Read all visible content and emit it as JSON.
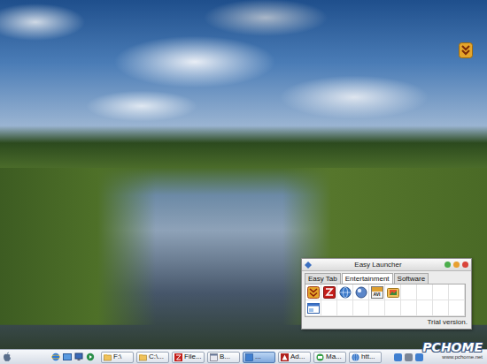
{
  "launcher": {
    "title": "Easy Launcher",
    "tabs": [
      {
        "label": "Easy Tab",
        "selected": false
      },
      {
        "label": "Entertainment",
        "selected": true
      },
      {
        "label": "Software",
        "selected": false
      }
    ],
    "rows": [
      [
        {
          "kind": "download"
        },
        {
          "kind": "filezilla"
        },
        {
          "kind": "globe"
        },
        {
          "kind": "ball"
        },
        {
          "kind": "video",
          "badge": "AVI"
        },
        {
          "kind": "picture"
        }
      ],
      [
        {
          "kind": "window"
        }
      ]
    ],
    "status": "Trial version."
  },
  "taskbar": {
    "tasks": [
      {
        "label": "F:\\",
        "kind": "folder",
        "selected": false
      },
      {
        "label": "C:\\...",
        "kind": "folder",
        "selected": false
      },
      {
        "label": "File...",
        "kind": "filezilla",
        "selected": false
      },
      {
        "label": "B...",
        "kind": "browser",
        "selected": false
      },
      {
        "label": "...",
        "kind": "app",
        "selected": true
      },
      {
        "label": "Ad...",
        "kind": "adobe",
        "selected": false
      },
      {
        "label": "Ma...",
        "kind": "mail",
        "selected": false
      },
      {
        "label": "htt...",
        "kind": "globe",
        "selected": false
      }
    ]
  },
  "watermark": {
    "logo": "PCHOME",
    "url": "www.pchome.net"
  }
}
